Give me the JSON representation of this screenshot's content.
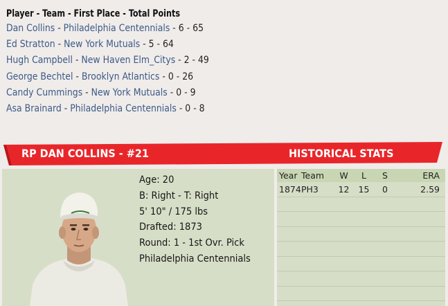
{
  "vote_list": {
    "header": "Player - Team - First Place - Total Points",
    "rows": [
      {
        "player": "Dan Collins",
        "team": "Philadelphia Centennials",
        "first": "6",
        "points": "65"
      },
      {
        "player": "Ed Stratton",
        "team": "New York Mutuals",
        "first": "5",
        "points": "64"
      },
      {
        "player": "Hugh Campbell",
        "team": "New Haven Elm_Citys",
        "first": "2",
        "points": "49"
      },
      {
        "player": "George Bechtel",
        "team": "Brooklyn Atlantics",
        "first": "0",
        "points": "26"
      },
      {
        "player": "Candy Cummings",
        "team": "New York Mutuals",
        "first": "0",
        "points": "9"
      },
      {
        "player": "Asa Brainard",
        "team": "Philadelphia Centennials",
        "first": "0",
        "points": "8"
      }
    ],
    "separator": " - "
  },
  "banner": {
    "title": "RP DAN COLLINS - #21",
    "historical": "HISTORICAL STATS",
    "color": "#e8262a"
  },
  "bio": {
    "age": "Age: 20",
    "bats_throws": "B: Right - T: Right",
    "size": "5' 10\" / 175 lbs",
    "drafted": "Drafted: 1873",
    "round": "Round: 1 - 1st Ovr. Pick",
    "team": "Philadelphia Centennials"
  },
  "stats": {
    "headers": {
      "year": "Year",
      "team": "Team",
      "w": "W",
      "l": "L",
      "s": "S",
      "era": "ERA"
    },
    "rows": [
      {
        "year": "1874",
        "team": "PH3",
        "w": "12",
        "l": "15",
        "s": "0",
        "era": "2.59"
      }
    ]
  }
}
